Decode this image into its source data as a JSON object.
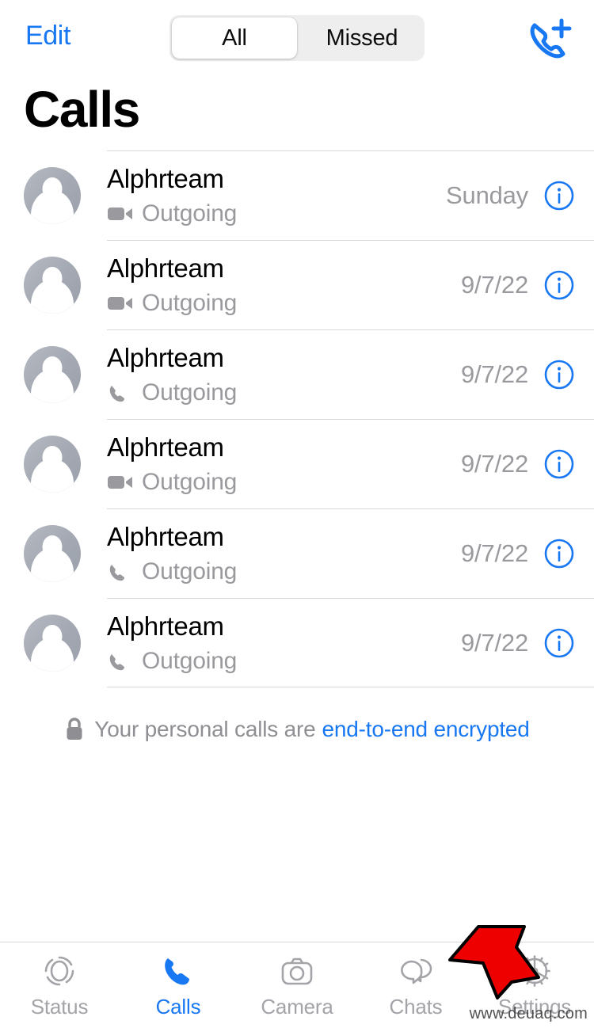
{
  "header": {
    "edit_label": "Edit",
    "new_call_icon": "phone-plus-icon",
    "segmented": {
      "options": [
        "All",
        "Missed"
      ],
      "selected": "All"
    }
  },
  "page_title": "Calls",
  "calls": [
    {
      "name": "Alphrteam",
      "type_icon": "video-camera-icon",
      "direction": "Outgoing",
      "date": "Sunday",
      "info_icon": "info-circle-icon"
    },
    {
      "name": "Alphrteam",
      "type_icon": "video-camera-icon",
      "direction": "Outgoing",
      "date": "9/7/22",
      "info_icon": "info-circle-icon"
    },
    {
      "name": "Alphrteam",
      "type_icon": "phone-icon",
      "direction": "Outgoing",
      "date": "9/7/22",
      "info_icon": "info-circle-icon"
    },
    {
      "name": "Alphrteam",
      "type_icon": "video-camera-icon",
      "direction": "Outgoing",
      "date": "9/7/22",
      "info_icon": "info-circle-icon"
    },
    {
      "name": "Alphrteam",
      "type_icon": "phone-icon",
      "direction": "Outgoing",
      "date": "9/7/22",
      "info_icon": "info-circle-icon"
    },
    {
      "name": "Alphrteam",
      "type_icon": "phone-icon",
      "direction": "Outgoing",
      "date": "9/7/22",
      "info_icon": "info-circle-icon"
    }
  ],
  "encryption_notice": {
    "lock_icon": "lock-icon",
    "text": "Your personal calls are",
    "link": "end-to-end encrypted"
  },
  "tabbar": {
    "tabs": [
      {
        "label": "Status",
        "icon": "status-rings-icon",
        "active": false
      },
      {
        "label": "Calls",
        "icon": "phone-icon",
        "active": true
      },
      {
        "label": "Camera",
        "icon": "camera-icon",
        "active": false
      },
      {
        "label": "Chats",
        "icon": "chat-bubbles-icon",
        "active": false
      },
      {
        "label": "Settings",
        "icon": "gear-icon",
        "active": false
      }
    ]
  },
  "annotation": {
    "arrow_icon": "red-arrow-icon",
    "points_to": "Settings"
  },
  "watermark": "www.deuaq.com",
  "colors": {
    "accent_blue": "#1877f2",
    "muted_gray": "#9a9a9e",
    "separator": "#d8d8d8",
    "arrow_red": "#ee0000"
  }
}
